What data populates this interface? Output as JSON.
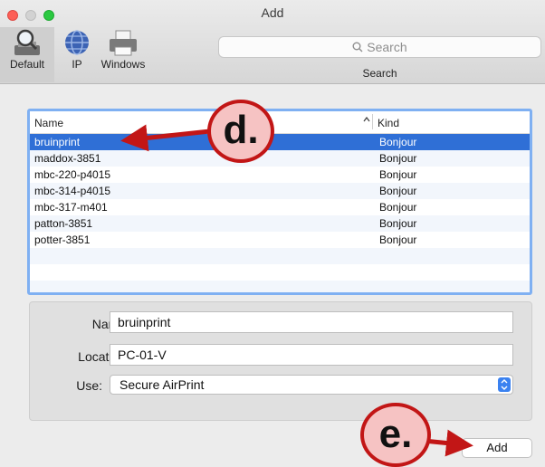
{
  "window": {
    "title": "Add"
  },
  "toolbar": {
    "items": [
      {
        "label": "Default",
        "icon": "magnifier-printer-icon",
        "selected": true
      },
      {
        "label": "IP",
        "icon": "globe-icon",
        "selected": false
      },
      {
        "label": "Windows",
        "icon": "printer-icon",
        "selected": false
      }
    ],
    "search": {
      "placeholder": "Search",
      "label": "Search"
    }
  },
  "printer_list": {
    "columns": {
      "name": "Name",
      "kind": "Kind",
      "sort_indicator": "^"
    },
    "rows": [
      {
        "name": "bruinprint",
        "kind": "Bonjour",
        "selected": true
      },
      {
        "name": "maddox-3851",
        "kind": "Bonjour"
      },
      {
        "name": "mbc-220-p4015",
        "kind": "Bonjour"
      },
      {
        "name": "mbc-314-p4015",
        "kind": "Bonjour"
      },
      {
        "name": "mbc-317-m401",
        "kind": "Bonjour"
      },
      {
        "name": "patton-3851",
        "kind": "Bonjour"
      },
      {
        "name": "potter-3851",
        "kind": "Bonjour"
      }
    ]
  },
  "details": {
    "name_label": "Name:",
    "name_value": "bruinprint",
    "location_label": "Location:",
    "location_value": "PC-01-V",
    "use_label": "Use:",
    "use_value": "Secure AirPrint"
  },
  "actions": {
    "add_label": "Add"
  },
  "annotations": {
    "d_label": "d.",
    "e_label": "e.",
    "color": "#c21616",
    "fill": "#f6c3c3"
  }
}
